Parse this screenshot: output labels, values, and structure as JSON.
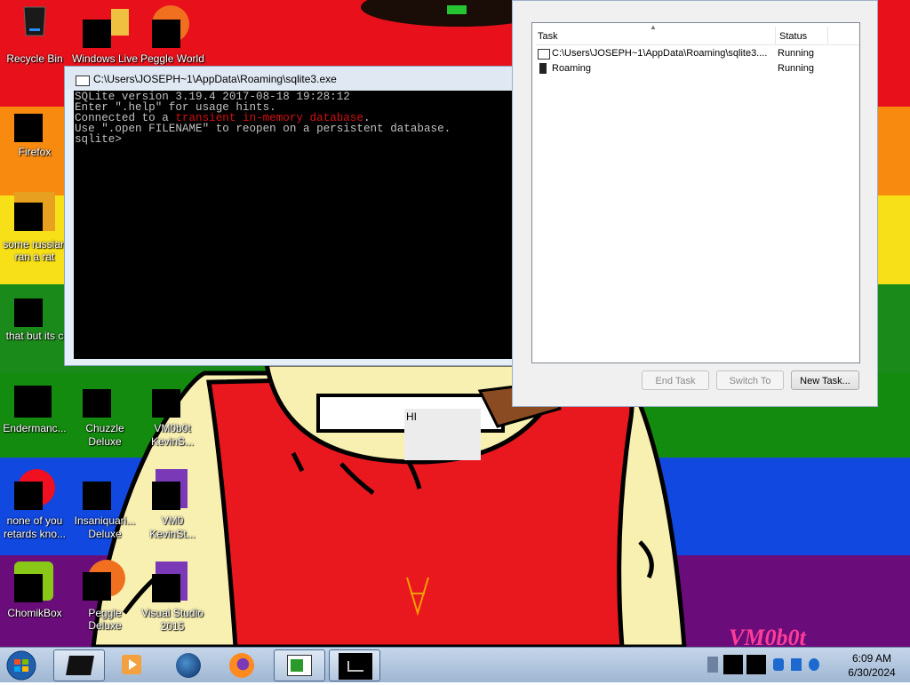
{
  "colors": {
    "stripe_red": "#e8101a",
    "stripe_orange": "#f98a10",
    "stripe_yellow": "#f7e017",
    "stripe_green": "#1a8a1a",
    "stripe_blue": "#1048e0",
    "stripe_purple": "#6a0d7a",
    "console_bg": "#000000",
    "console_text": "#c0c0c0",
    "console_highlight": "#d41010"
  },
  "desktop": {
    "icons": [
      {
        "label": "Recycle Bin",
        "icon": "recycle-bin-icon"
      },
      {
        "label": "Windows Live",
        "icon": "windows-live-icon"
      },
      {
        "label": "Peggle World",
        "icon": "peggle-world-icon"
      },
      {
        "label": "Firefox",
        "icon": "firefox-icon"
      },
      {
        "label_line1": "some russian",
        "label_line2": "ran a rat",
        "icon": "shortcut-icon"
      },
      {
        "label": "that but its c",
        "icon": "folder-icon"
      },
      {
        "label": "Endermanc...",
        "icon": "console-app-icon"
      },
      {
        "label_line1": "Chuzzle",
        "label_line2": "Deluxe",
        "icon": "chuzzle-icon"
      },
      {
        "label_line1": "VM0b0t",
        "label_line2": "KevinS...",
        "icon": "visual-studio-icon"
      },
      {
        "label_line1": "none of you",
        "label_line2": "retards kno...",
        "icon": "opera-icon"
      },
      {
        "label_line1": "Insaniquari...",
        "label_line2": "Deluxe",
        "icon": "insaniquarium-icon"
      },
      {
        "label_line1": "VM0",
        "label_line2": "KevinSt...",
        "icon": "visual-studio-icon-2"
      },
      {
        "label": "ChomikBox",
        "icon": "chomikbox-icon"
      },
      {
        "label": "Peggle Deluxe",
        "icon": "peggle-deluxe-icon"
      },
      {
        "label_line1": "Visual Studio",
        "label_line2": "2015",
        "icon": "visual-studio-2015-icon"
      }
    ],
    "overlay_text": "HI",
    "watermark": "VM0b0t"
  },
  "console": {
    "title": "C:\\Users\\JOSEPH~1\\AppData\\Roaming\\sqlite3.exe",
    "line1": "SQLite version 3.19.4 2017-08-18 19:28:12",
    "line2": "Enter \".help\" for usage hints.",
    "line3_a": "Connected to a ",
    "line3_b": "transient in-memory database",
    "line3_c": ".",
    "line4": "Use \".open FILENAME\" to reopen on a persistent database.",
    "prompt": "sqlite>"
  },
  "taskmgr": {
    "columns": {
      "task": "Task",
      "status": "Status"
    },
    "rows": [
      {
        "task": "C:\\Users\\JOSEPH~1\\AppData\\Roaming\\sqlite3....",
        "status": "Running"
      },
      {
        "task": "Roaming",
        "status": "Running"
      }
    ],
    "buttons": {
      "end_task": "End Task",
      "switch_to": "Switch To",
      "new_task": "New Task..."
    }
  },
  "taskbar": {
    "clock_time": "6:09 AM",
    "clock_date": "6/30/2024"
  }
}
